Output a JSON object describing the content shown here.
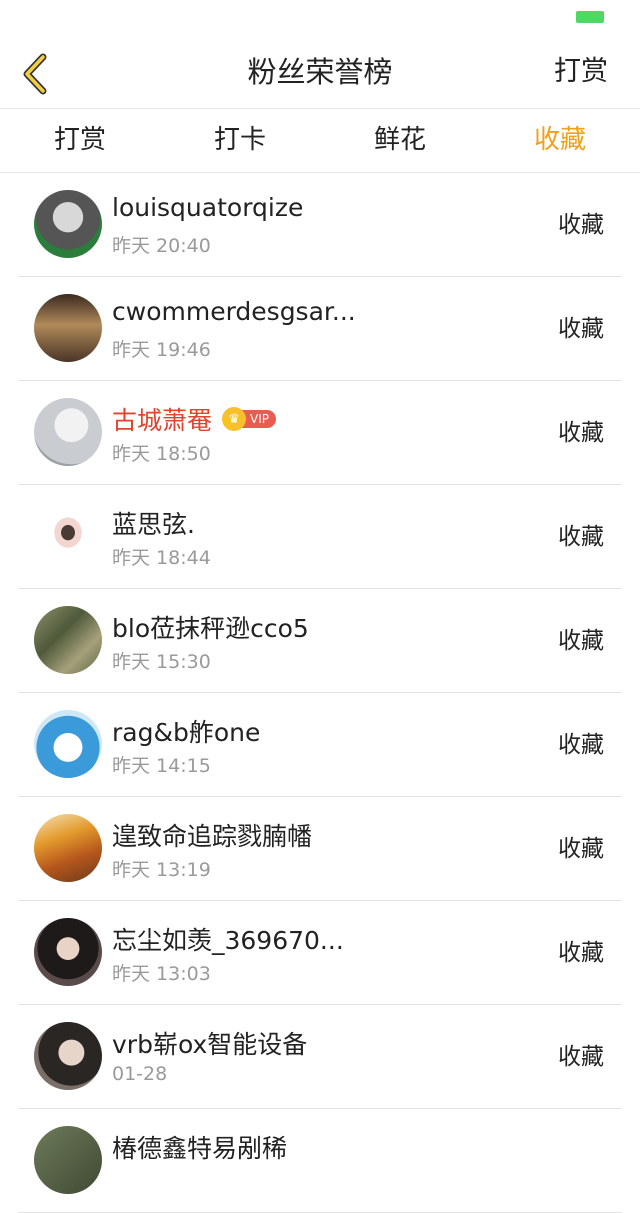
{
  "nav": {
    "title": "粉丝荣誉榜",
    "right_label": "打赏"
  },
  "tabs": [
    {
      "label": "打赏",
      "active": false
    },
    {
      "label": "打卡",
      "active": false
    },
    {
      "label": "鲜花",
      "active": false
    },
    {
      "label": "收藏",
      "active": true
    }
  ],
  "rows": [
    {
      "name": "louisquatorqize",
      "time": "昨天 20:40",
      "action": "收藏",
      "vip": false
    },
    {
      "name": "cwommerdesgsar...",
      "time": "昨天 19:46",
      "action": "收藏",
      "vip": false
    },
    {
      "name": "古城萧罨",
      "time": "昨天 18:50",
      "action": "收藏",
      "vip": true,
      "vip_label": "VIP"
    },
    {
      "name": "蓝思弦.",
      "time": "昨天 18:44",
      "action": "收藏",
      "vip": false
    },
    {
      "name": "blo莅抹秤逊cco5",
      "time": "昨天 15:30",
      "action": "收藏",
      "vip": false
    },
    {
      "name": "rag&b舴one",
      "time": "昨天 14:15",
      "action": "收藏",
      "vip": false
    },
    {
      "name": "遑致命追踪戮腩幡",
      "time": "昨天 13:19",
      "action": "收藏",
      "vip": false
    },
    {
      "name": "忘尘如羡_369670...",
      "time": "昨天 13:03",
      "action": "收藏",
      "vip": false
    },
    {
      "name": "vrb崭ox智能设备",
      "time": "01-28",
      "action": "收藏",
      "vip": false
    },
    {
      "name": "椿德鑫特易剐稀",
      "time": "",
      "action": "",
      "vip": false
    }
  ],
  "colors": {
    "accent": "#f0a01a",
    "vip_name": "#e0442f",
    "battery": "#4cd964"
  }
}
